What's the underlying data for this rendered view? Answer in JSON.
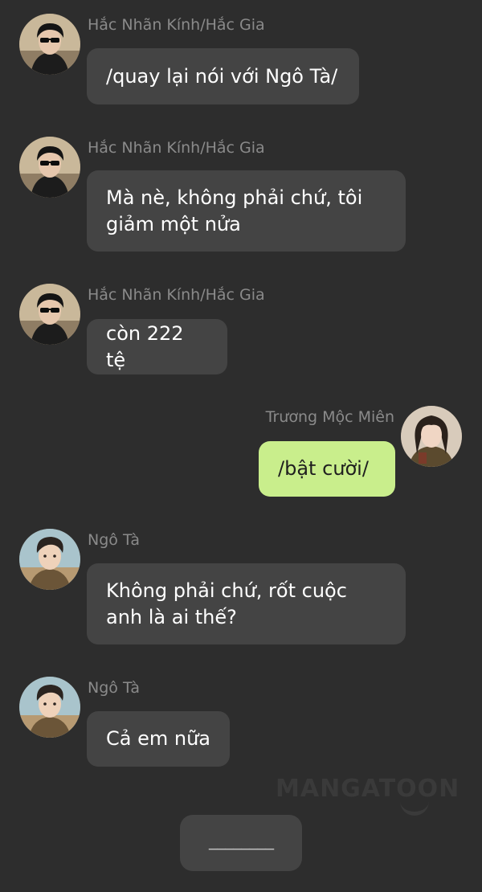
{
  "chat": {
    "messages": [
      {
        "sender": "Hắc Nhãn Kính/Hắc Gia",
        "text": "/quay lại nói với Ngô Tà/",
        "side": "left"
      },
      {
        "sender": "Hắc Nhãn Kính/Hắc Gia",
        "text": "Mà nè, không phải chứ, tôi giảm một nửa",
        "side": "left"
      },
      {
        "sender": "Hắc Nhãn Kính/Hắc Gia",
        "text": "còn 222 tệ",
        "side": "left"
      },
      {
        "sender": "Trương Mộc Miên",
        "text": "/bật cười/",
        "side": "right"
      },
      {
        "sender": "Ngô Tà",
        "text": "Không phải chứ, rốt cuộc anh là ai thế?",
        "side": "left"
      },
      {
        "sender": "Ngô Tà",
        "text": "Cả em nữa",
        "side": "left"
      }
    ]
  },
  "watermark": {
    "text": "MANGATOON"
  },
  "reply_button": {
    "label": "________"
  },
  "colors": {
    "background": "#2d2d2d",
    "bubble_other": "#444444",
    "bubble_mine": "#c9ee8c",
    "name_text": "#8a8a8a"
  },
  "icons": {
    "sender_avatar_1": "avatar-sunglasses-man",
    "sender_avatar_2": "avatar-young-woman",
    "sender_avatar_3": "avatar-young-man"
  }
}
